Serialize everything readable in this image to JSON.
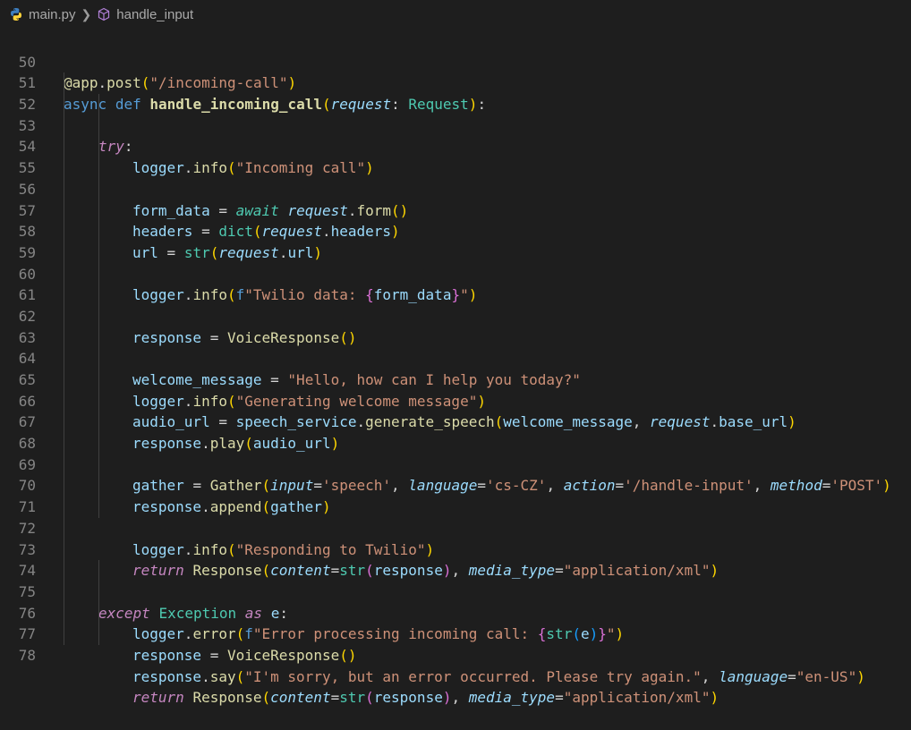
{
  "breadcrumb": {
    "file": "main.py",
    "symbol": "handle_input"
  },
  "lines": [
    {
      "n": "50",
      "text": "@app.post(\"/incoming-call\")"
    },
    {
      "n": "51",
      "text": "async def handle_incoming_call(request: Request):"
    },
    {
      "n": "52",
      "text": "try:"
    },
    {
      "n": "53",
      "text": "logger.info(\"Incoming call\")"
    },
    {
      "n": "54",
      "text": ""
    },
    {
      "n": "55",
      "text": "form_data = await request.form()"
    },
    {
      "n": "56",
      "text": "headers = dict(request.headers)"
    },
    {
      "n": "57",
      "text": "url = str(request.url)"
    },
    {
      "n": "58",
      "text": ""
    },
    {
      "n": "59",
      "text": "logger.info(f\"Twilio data: {form_data}\")"
    },
    {
      "n": "60",
      "text": ""
    },
    {
      "n": "61",
      "text": "response = VoiceResponse()"
    },
    {
      "n": "62",
      "text": ""
    },
    {
      "n": "63",
      "text": "welcome_message = \"Hello, how can I help you today?\""
    },
    {
      "n": "64",
      "text": "logger.info(\"Generating welcome message\")"
    },
    {
      "n": "65",
      "text": "audio_url = speech_service.generate_speech(welcome_message, request.base_url)"
    },
    {
      "n": "66",
      "text": "response.play(audio_url)"
    },
    {
      "n": "67",
      "text": ""
    },
    {
      "n": "68",
      "text": "gather = Gather(input='speech', language='cs-CZ', action='/handle-input', method='POST')"
    },
    {
      "n": "69",
      "text": "response.append(gather)"
    },
    {
      "n": "70",
      "text": ""
    },
    {
      "n": "71",
      "text": "logger.info(\"Responding to Twilio\")"
    },
    {
      "n": "72",
      "text": "return Response(content=str(response), media_type=\"application/xml\")"
    },
    {
      "n": "73",
      "text": ""
    },
    {
      "n": "74",
      "text": "except Exception as e:"
    },
    {
      "n": "75",
      "text": "logger.error(f\"Error processing incoming call: {str(e)}\")"
    },
    {
      "n": "76",
      "text": "response = VoiceResponse()"
    },
    {
      "n": "77",
      "text": "response.say(\"I'm sorry, but an error occurred. Please try again.\", language=\"en-US\")"
    },
    {
      "n": "78",
      "text": "return Response(content=str(response), media_type=\"application/xml\")"
    }
  ]
}
